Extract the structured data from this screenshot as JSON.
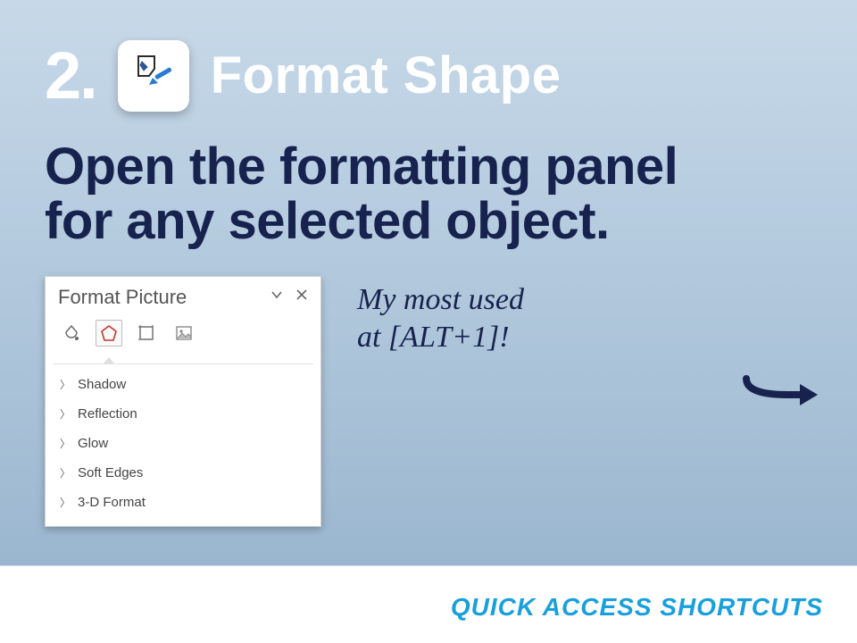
{
  "header": {
    "step_number": "2.",
    "title": "Format Shape"
  },
  "subtitle_line1": "Open the formatting panel",
  "subtitle_line2": "for any selected object.",
  "panel": {
    "title": "Format Picture",
    "items": [
      "Shadow",
      "Reflection",
      "Glow",
      "Soft Edges",
      "3-D Format"
    ]
  },
  "note_line1": "My most used",
  "note_line2": "at [ALT+1]!",
  "footer": "QUICK ACCESS SHORTCUTS"
}
